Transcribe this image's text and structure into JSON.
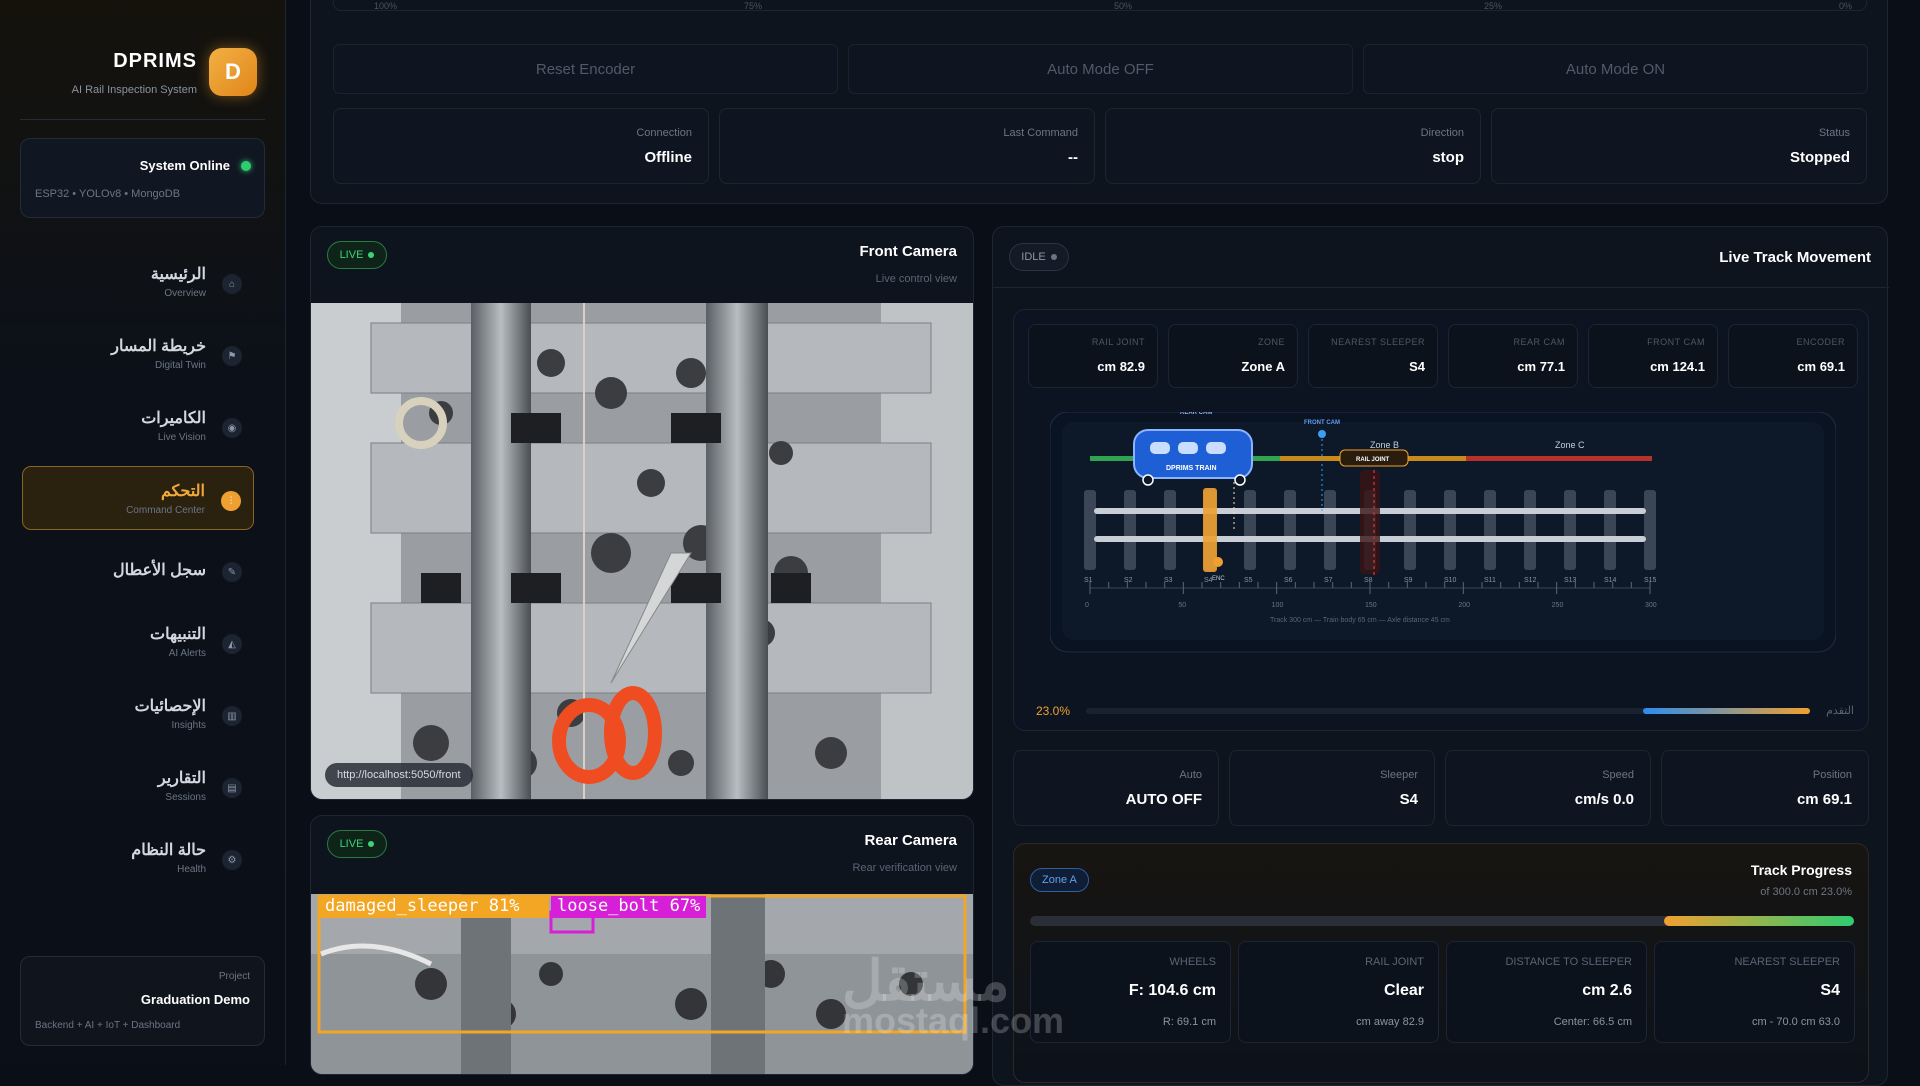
{
  "brand": {
    "name": "DPRIMS",
    "subtitle": "AI Rail Inspection System",
    "logo_letter": "D"
  },
  "system": {
    "status": "System Online",
    "stack": "ESP32 • YOLOv8 • MongoDB"
  },
  "nav": [
    {
      "ar": "الرئيسية",
      "en": "Overview",
      "icon": "home-icon"
    },
    {
      "ar": "خريطة المسار",
      "en": "Digital Twin",
      "icon": "flag-icon"
    },
    {
      "ar": "الكاميرات",
      "en": "Live Vision",
      "icon": "camera-icon"
    },
    {
      "ar": "التحكم",
      "en": "Command Center",
      "icon": "sliders-icon",
      "active": true
    },
    {
      "ar": "سجل الأعطال",
      "en": "",
      "icon": "wrench-icon"
    },
    {
      "ar": "التنبيهات",
      "en": "AI Alerts",
      "icon": "bell-icon"
    },
    {
      "ar": "الإحصائيات",
      "en": "Insights",
      "icon": "chart-icon"
    },
    {
      "ar": "التقارير",
      "en": "Sessions",
      "icon": "document-icon"
    },
    {
      "ar": "حالة النظام",
      "en": "Health",
      "icon": "gear-icon"
    }
  ],
  "project": {
    "label": "Project",
    "name": "Graduation Demo",
    "stack": "Backend + AI + IoT + Dashboard"
  },
  "control": {
    "scale_ticks": [
      "100%",
      "75%",
      "50%",
      "25%",
      "0%"
    ],
    "buttons": [
      "Reset Encoder",
      "Auto Mode OFF",
      "Auto Mode ON"
    ],
    "status": [
      {
        "label": "Connection",
        "value": "Offline"
      },
      {
        "label": "Last Command",
        "value": "--"
      },
      {
        "label": "Direction",
        "value": "stop"
      },
      {
        "label": "Status",
        "value": "Stopped"
      }
    ]
  },
  "front_camera": {
    "badge": "LIVE",
    "title": "Front Camera",
    "subtitle": "Live control view",
    "url": "http://localhost:5050/front"
  },
  "rear_camera": {
    "badge": "LIVE",
    "title": "Rear Camera",
    "subtitle": "Rear verification view",
    "detections": [
      "damaged_sleeper 81%",
      "loose_bolt 67%"
    ]
  },
  "track": {
    "badge": "IDLE",
    "title": "Live Track Movement",
    "metrics": [
      {
        "k": "RAIL JOINT",
        "v": "cm 82.9"
      },
      {
        "k": "ZONE",
        "v": "Zone A"
      },
      {
        "k": "NEAREST SLEEPER",
        "v": "S4"
      },
      {
        "k": "REAR CAM",
        "v": "cm 77.1"
      },
      {
        "k": "FRONT CAM",
        "v": "cm 124.1"
      },
      {
        "k": "ENCODER",
        "v": "cm 69.1"
      }
    ],
    "diagram": {
      "rear_cam_label": "REAR CAM",
      "front_cam_label": "FRONT CAM",
      "train_label": "DPRIMS TRAIN",
      "zone_b": "Zone B",
      "zone_c": "Zone C",
      "rail_joint": "RAIL JOINT",
      "enc": "ENC",
      "sleepers": [
        "S1",
        "S2",
        "S3",
        "S4",
        "S5",
        "S6",
        "S7",
        "S8",
        "S9",
        "S10",
        "S11",
        "S12",
        "S13",
        "S14",
        "S15"
      ],
      "scale": [
        "0",
        "50",
        "100",
        "150",
        "200",
        "250",
        "300"
      ],
      "caption": "Track 300 cm — Train body 65 cm — Axle distance 45 cm",
      "colors": {
        "zone_a": "#2fa34f",
        "zone_b": "#c98a1c",
        "zone_c": "#b8322c",
        "train": "#1f5fd6",
        "accent": "#f0a030"
      }
    },
    "progress": {
      "percent": "23.0%",
      "fraction": 0.23,
      "label": "التقدم"
    },
    "summary": [
      {
        "label": "Auto",
        "value": "AUTO OFF"
      },
      {
        "label": "Sleeper",
        "value": "S4"
      },
      {
        "label": "Speed",
        "value": "cm/s 0.0"
      },
      {
        "label": "Position",
        "value": "cm 69.1"
      }
    ]
  },
  "track_progress": {
    "badge": "Zone A",
    "title": "Track Progress",
    "subtitle": "of 300.0 cm 23.0%",
    "fraction": 0.23,
    "cards": [
      {
        "k": "WHEELS",
        "v": "F: 104.6 cm",
        "s": "R: 69.1 cm"
      },
      {
        "k": "RAIL JOINT",
        "v": "Clear",
        "s": "cm away 82.9"
      },
      {
        "k": "DISTANCE TO SLEEPER",
        "v": "cm 2.6",
        "s": "Center: 66.5 cm"
      },
      {
        "k": "NEAREST SLEEPER",
        "v": "S4",
        "s": "cm - 70.0 cm 63.0"
      }
    ]
  },
  "watermark": {
    "ar": "مستقل",
    "en": "mostaql.com"
  }
}
